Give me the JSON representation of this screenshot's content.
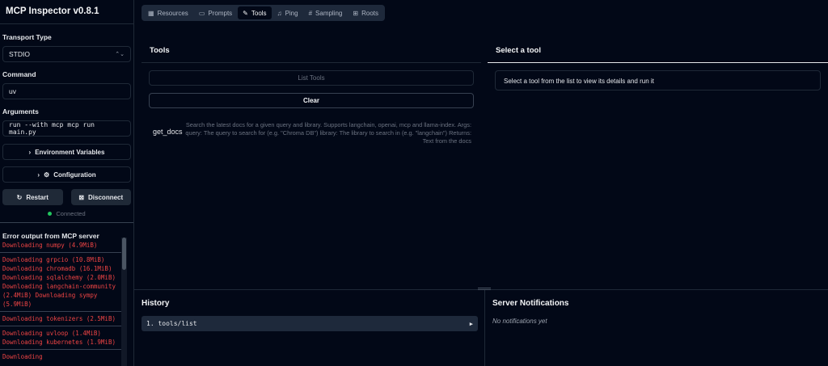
{
  "app": {
    "title": "MCP Inspector v0.8.1"
  },
  "sidebar": {
    "transport_label": "Transport Type",
    "transport_value": "STDIO",
    "command_label": "Command",
    "command_value": "uv",
    "arguments_label": "Arguments",
    "arguments_value": "run --with mcp mcp run main.py",
    "env_button": "Environment Variables",
    "config_button": "Configuration",
    "restart_button": "Restart",
    "disconnect_button": "Disconnect",
    "status": "Connected",
    "error_header": "Error output from MCP server",
    "log": [
      "Downloading numpy (4.9MiB)",
      "Downloading grpcio (10.8MiB)\nDownloading chromadb (16.1MiB)\nDownloading sqlalchemy (2.0MiB)\nDownloading langchain-community\n(2.4MiB) Downloading sympy\n(5.9MiB)",
      "Downloading tokenizers (2.5MiB)",
      "Downloading uvloop (1.4MiB)\nDownloading kubernetes (1.9MiB)",
      "Downloading"
    ]
  },
  "tabs": [
    {
      "label": "Resources",
      "icon": "resources-icon"
    },
    {
      "label": "Prompts",
      "icon": "prompts-icon"
    },
    {
      "label": "Tools",
      "icon": "tools-icon"
    },
    {
      "label": "Ping",
      "icon": "ping-icon"
    },
    {
      "label": "Sampling",
      "icon": "sampling-icon"
    },
    {
      "label": "Roots",
      "icon": "roots-icon"
    }
  ],
  "tools_panel": {
    "title": "Tools",
    "list_button": "List Tools",
    "clear_button": "Clear",
    "tools": [
      {
        "name": "get_docs",
        "description": "Search the latest docs for a given query and library. Supports langchain, openai, mcp and llama-index. Args: query: The query to search for (e.g. \"Chroma DB\") library: The library to search in (e.g. \"langchain\") Returns: Text from the docs"
      }
    ]
  },
  "detail_panel": {
    "title": "Select a tool",
    "placeholder": "Select a tool from the list to view its details and run it"
  },
  "history": {
    "title": "History",
    "items": [
      "1. tools/list"
    ]
  },
  "notifications": {
    "title": "Server Notifications",
    "empty": "No notifications yet"
  },
  "colors": {
    "error": "#ef4444",
    "connected": "#22c55e",
    "background": "#020817"
  }
}
